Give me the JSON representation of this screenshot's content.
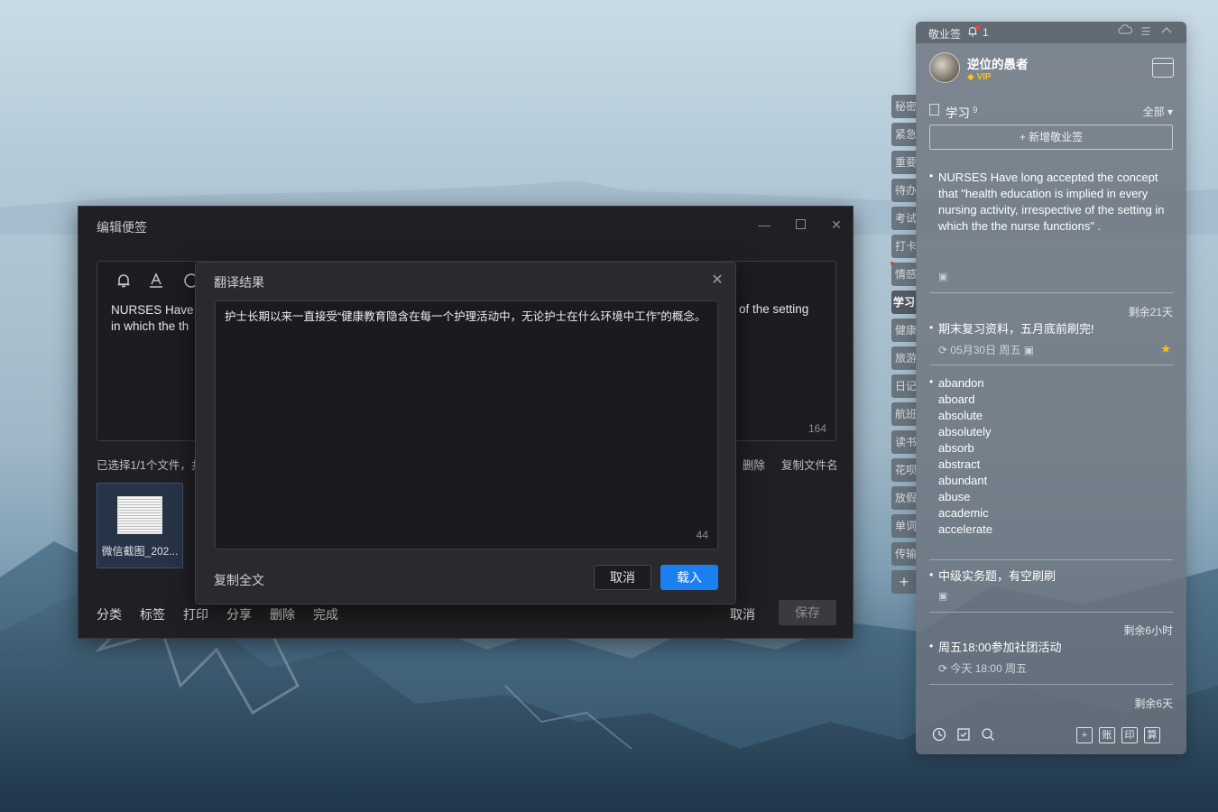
{
  "editor": {
    "title": "编辑便签",
    "note_text_left": "NURSES Have l",
    "note_text_left_line2": "in which the th",
    "note_text_right": "of the setting",
    "char_count": "164",
    "file_info": "已选择1/1个文件，共",
    "file_delete": "删除",
    "file_copy_name": "复制文件名",
    "file_name": "微信截图_202...",
    "bottom_actions": [
      "分类",
      "标签",
      "打印",
      "分享",
      "删除",
      "完成"
    ],
    "cancel": "取消",
    "save": "保存"
  },
  "dialog": {
    "title": "翻译结果",
    "content": "护士长期以来一直接受“健康教育隐含在每一个护理活动中，无论护士在什么环境中工作”的概念。",
    "char_count": "44",
    "copy_all": "复制全文",
    "cancel": "取消",
    "load": "载入"
  },
  "tabs": [
    "秘密",
    "紧急",
    "重要",
    "待办",
    "考试",
    "打卡",
    "情感",
    "学习",
    "健康",
    "旅游",
    "日记",
    "航班",
    "读书",
    "花呗",
    "放假",
    "单词",
    "传输",
    "+"
  ],
  "panel": {
    "app_name": "敬业签",
    "bell_count": "1",
    "user_name": "逆位的愚者",
    "vip": "VIP",
    "category": "学习",
    "category_count": "9",
    "filter": "全部",
    "add_button": "+ 新增敬业签",
    "notes": [
      {
        "text": "NURSES Have long accepted the concept that \"health education is implied in every nursing activity, irrespective of the setting in which the the nurse functions\" ."
      },
      {
        "remain": "剩余21天",
        "text": "期末复习资料，五月底前刷完!",
        "meta": "05月30日 周五"
      },
      {
        "words": [
          "abandon",
          "aboard",
          "absolute",
          "absolutely",
          "absorb",
          "abstract",
          "abundant",
          "abuse",
          "academic",
          "accelerate"
        ]
      },
      {
        "text": "中级实务题，有空刷刷"
      },
      {
        "remain": "剩余6小时",
        "text": "周五18:00参加社团活动",
        "meta": "今天 18:00 周五"
      },
      {
        "remain": "剩余6天"
      }
    ],
    "footer_boxes": [
      "+",
      "账",
      "印",
      "算"
    ]
  }
}
